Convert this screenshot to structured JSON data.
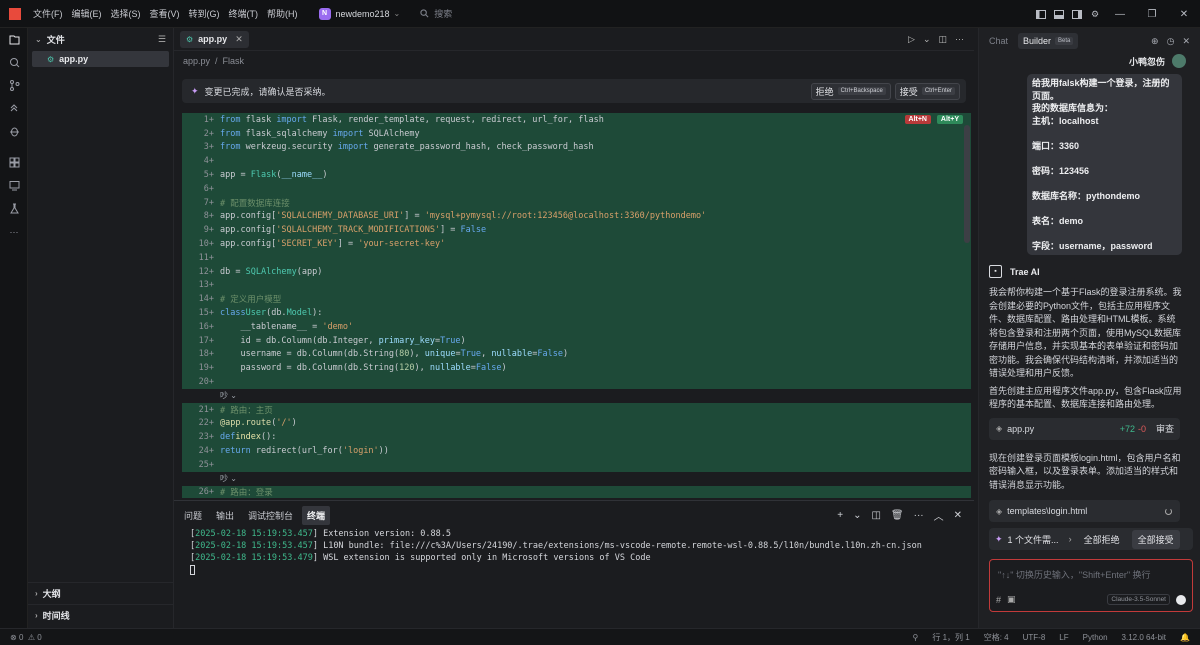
{
  "titlebar": {
    "menus": [
      "文件(F)",
      "编辑(E)",
      "选择(S)",
      "查看(V)",
      "转到(G)",
      "终端(T)",
      "帮助(H)"
    ],
    "project_badge": "N",
    "project_name": "newdemo218",
    "search_placeholder": "搜索"
  },
  "explorer": {
    "title": "文件",
    "file": "app.py",
    "outline": "大纲",
    "timeline": "时间线"
  },
  "editor": {
    "tab": "app.py",
    "breadcrumb": [
      "app.py",
      "Flask"
    ],
    "change_message": "变更已完成，请确认是否采纳。",
    "reject_label": "拒绝",
    "reject_kbd": "Ctrl+Backspace",
    "accept_label": "接受",
    "accept_kbd": "Ctrl+Enter",
    "tag_n": "Alt+N",
    "tag_y": "Alt+Y",
    "fold_marker": "吵 ⌄"
  },
  "panel": {
    "tabs": [
      "问题",
      "输出",
      "调试控制台",
      "终端"
    ],
    "terminal": [
      {
        "ts": "",
        "text": "Extension version: 0.88.5",
        "prefix": "["
      },
      {
        "ts": "2025-02-18 15:19:53.457",
        "text": "L10N bundle: file:///c%3A/Users/24190/.trae/extensions/ms-vscode-remote.remote-wsl-0.88.5/l10n/bundle.l10n.zh-cn.json"
      },
      {
        "ts": "2025-02-18 15:19:53.479",
        "text": "WSL extension is supported only in Microsoft versions of VS Code"
      }
    ],
    "first_ts": "2025-02-18 15:19:53.457"
  },
  "chat": {
    "tab_chat": "Chat",
    "tab_builder": "Builder",
    "beta": "Beta",
    "username": "小鸭忽伤",
    "user_message_lines": [
      "给我用falsk构建一个登录，注册的页面。",
      "我的数据库信息为：",
      "主机：localhost",
      "",
      "端口：3360",
      "",
      "密码：123456",
      "",
      "数据库名称：pythondemo",
      "",
      "表名：demo",
      "",
      "字段：username，password"
    ],
    "ai_name": "Trae AI",
    "ai_text_1": "我会帮你构建一个基于Flask的登录注册系统。我会创建必要的Python文件，包括主应用程序文件、数据库配置、路由处理和HTML模板。系统将包含登录和注册两个页面，使用MySQL数据库存储用户信息，并实现基本的表单验证和密码加密功能。我会确保代码结构清晰，并添加适当的错误处理和用户反馈。",
    "ai_text_2": "首先创建主应用程序文件app.py，包含Flask应用程序的基本配置、数据库连接和路由处理。",
    "file1_name": "app.py",
    "file1_add": "+72",
    "file1_del": "-0",
    "file1_review": "审查",
    "ai_text_3": "现在创建登录页面模板login.html，包含用户名和密码输入框，以及登录表单。添加适当的样式和错误消息显示功能。",
    "file2_name": "templates\\login.html",
    "pending_text": "1 个文件需...",
    "reject_all": "全部拒绝",
    "accept_all": "全部接受",
    "input_placeholder": "\"↑↓\" 切换历史输入，\"Shift+Enter\" 换行",
    "model": "Claude-3.5-Sonnet"
  },
  "statusbar": {
    "errors": "0",
    "warnings": "0",
    "position": "行 1，列 1",
    "spaces": "空格: 4",
    "encoding": "UTF-8",
    "eol": "LF",
    "language": "Python",
    "python_version": "3.12.0 64-bit"
  }
}
